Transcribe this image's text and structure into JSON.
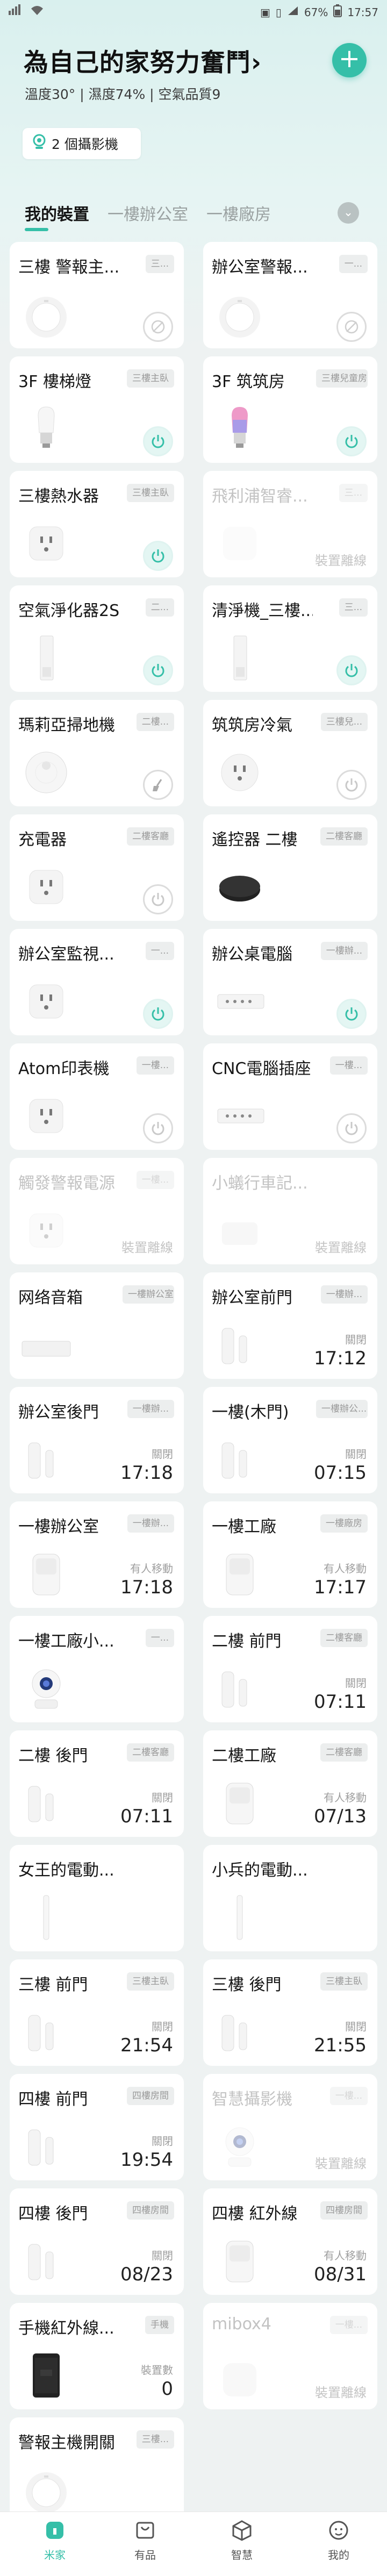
{
  "status_bar": {
    "left_icons": [
      "carrier-icon",
      "wifi-icon"
    ],
    "battery": "67%",
    "time": "17:57"
  },
  "home": {
    "title": "為自己的家努力奮鬥",
    "title_arrow": "›",
    "subtitle": "溫度30° | 濕度74% | 空氣品質9",
    "add_label": "+",
    "camera_pill": "2 個攝影機"
  },
  "tabs": {
    "items": [
      "我的裝置",
      "一樓辦公室",
      "一樓廠房"
    ],
    "active_index": 0,
    "dropdown": "⌄"
  },
  "accent_color": "#35bfa8",
  "devices": [
    {
      "name": "三樓 警報主...",
      "room": "三...",
      "type": "gateway",
      "control": "disabled"
    },
    {
      "name": "辦公室警報...",
      "room": "一...",
      "type": "gateway",
      "control": "disabled"
    },
    {
      "name": "3F 樓梯燈",
      "room": "三樓主臥",
      "type": "bulb",
      "control": "on"
    },
    {
      "name": "3F 筑筑房",
      "room": "三樓兒童房",
      "type": "bulb-color",
      "control": "on"
    },
    {
      "name": "三樓熱水器",
      "room": "三樓主臥",
      "type": "plug",
      "control": "on"
    },
    {
      "name": "飛利浦智睿...",
      "room": "三...",
      "type": "philips",
      "offline": true,
      "status_label": "裝置離線"
    },
    {
      "name": "空氣淨化器2S",
      "room": "二...",
      "type": "purifier",
      "control": "on"
    },
    {
      "name": "清淨機_三樓...",
      "room": "三...",
      "type": "purifier",
      "control": "on"
    },
    {
      "name": "瑪莉亞掃地機",
      "room": "二樓...",
      "type": "vacuum",
      "control": "broom"
    },
    {
      "name": "筑筑房冷氣",
      "room": "三樓兒...",
      "type": "plug-round",
      "control": "off"
    },
    {
      "name": "充電器",
      "room": "二樓客廳",
      "type": "plug",
      "control": "off"
    },
    {
      "name": "遙控器 二樓",
      "room": "二樓客廳",
      "type": "remote",
      "control": "none"
    },
    {
      "name": "辦公室監視...",
      "room": "一...",
      "type": "plug",
      "control": "on"
    },
    {
      "name": "辦公桌電腦",
      "room": "一樓辦...",
      "type": "strip",
      "control": "on"
    },
    {
      "name": "Atom印表機",
      "room": "一樓...",
      "type": "plug",
      "control": "off"
    },
    {
      "name": "CNC電腦插座",
      "room": "一樓...",
      "type": "strip",
      "control": "off"
    },
    {
      "name": "觸發警報電源",
      "room": "一樓...",
      "type": "plug",
      "offline": true,
      "status_label": "裝置離線"
    },
    {
      "name": "小蟻行車記...",
      "room": "",
      "type": "dashcam",
      "offline": true,
      "status_label": "裝置離線"
    },
    {
      "name": "网络音箱",
      "room": "一樓辦公室",
      "type": "speaker",
      "control": "none"
    },
    {
      "name": "辦公室前門",
      "room": "一樓辦...",
      "type": "door",
      "status_label": "關閉",
      "status_value": "17:12"
    },
    {
      "name": "辦公室後門",
      "room": "一樓辦...",
      "type": "door",
      "status_label": "關閉",
      "status_value": "17:18"
    },
    {
      "name": "一樓(木門)",
      "room": "一樓辦公...",
      "type": "door",
      "status_label": "關閉",
      "status_value": "07:15"
    },
    {
      "name": "一樓辦公室",
      "room": "一樓辦...",
      "type": "motion",
      "status_label": "有人移動",
      "status_value": "17:18"
    },
    {
      "name": "一樓工廠",
      "room": "一樓廠房",
      "type": "motion",
      "status_label": "有人移動",
      "status_value": "17:17"
    },
    {
      "name": "一樓工廠小...",
      "room": "一...",
      "type": "camera",
      "control": "none"
    },
    {
      "name": "二樓 前門",
      "room": "二樓客廳",
      "type": "door",
      "status_label": "關閉",
      "status_value": "07:11"
    },
    {
      "name": "二樓 後門",
      "room": "二樓客廳",
      "type": "door",
      "status_label": "關閉",
      "status_value": "07:11"
    },
    {
      "name": "二樓工廠",
      "room": "二樓客廳",
      "type": "motion",
      "status_label": "有人移動",
      "status_value": "07/13"
    },
    {
      "name": "女王的電動...",
      "room": "",
      "type": "toothbrush",
      "control": "none"
    },
    {
      "name": "小兵的電動...",
      "room": "",
      "type": "toothbrush",
      "control": "none"
    },
    {
      "name": "三樓 前門",
      "room": "三樓主臥",
      "type": "door",
      "status_label": "關閉",
      "status_value": "21:54"
    },
    {
      "name": "三樓 後門",
      "room": "三樓主臥",
      "type": "door",
      "status_label": "關閉",
      "status_value": "21:55"
    },
    {
      "name": "四樓 前門",
      "room": "四樓房間",
      "type": "door",
      "status_label": "關閉",
      "status_value": "19:54"
    },
    {
      "name": "智慧攝影機",
      "room": "一樓...",
      "type": "camera",
      "offline": true,
      "status_label": "裝置離線"
    },
    {
      "name": "四樓 後門",
      "room": "四樓房間",
      "type": "door",
      "status_label": "關閉",
      "status_value": "08/23"
    },
    {
      "name": "四樓 紅外線",
      "room": "四樓房間",
      "type": "motion",
      "status_label": "有人移動",
      "status_value": "08/31"
    },
    {
      "name": "手機紅外線...",
      "room": "手機",
      "type": "phone",
      "status_label": "裝置數",
      "status_value": "0"
    },
    {
      "name": "mibox4",
      "room": "一樓...",
      "type": "mibox",
      "offline": true,
      "status_label": "裝置離線"
    },
    {
      "name": "警報主機開關",
      "room": "三樓...",
      "type": "gateway",
      "control": "none"
    }
  ],
  "bottom_nav": [
    {
      "label": "米家",
      "icon": "home-icon",
      "active": true
    },
    {
      "label": "有品",
      "icon": "shop-icon",
      "active": false
    },
    {
      "label": "智慧",
      "icon": "smart-icon",
      "active": false
    },
    {
      "label": "我的",
      "icon": "profile-icon",
      "active": false
    }
  ]
}
